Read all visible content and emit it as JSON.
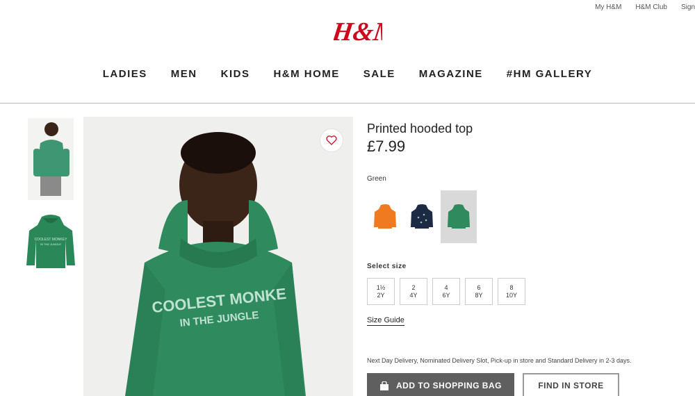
{
  "header": {
    "util_links": [
      "My H&M",
      "H&M Club",
      "Sign"
    ],
    "logo_text": "H&M",
    "nav": [
      "LADIES",
      "MEN",
      "KIDS",
      "H&M HOME",
      "SALE",
      "MAGAZINE",
      "#HM GALLERY"
    ]
  },
  "product": {
    "title": "Printed hooded top",
    "price": "£7.99",
    "color_label": "Green",
    "hoodie_print_line1": "COOLEST MONKE",
    "hoodie_print_line2": "IN THE JUNGLE",
    "swatches": [
      {
        "name": "orange",
        "color": "#ef7a1f"
      },
      {
        "name": "navy",
        "color": "#1c2a44"
      },
      {
        "name": "green",
        "color": "#2f8a5e",
        "selected": true
      }
    ],
    "size_label": "Select size",
    "sizes": [
      {
        "top": "1½",
        "bottom": "2Y"
      },
      {
        "top": "2",
        "bottom": "4Y"
      },
      {
        "top": "4",
        "bottom": "6Y"
      },
      {
        "top": "6",
        "bottom": "8Y"
      },
      {
        "top": "8",
        "bottom": "10Y"
      }
    ],
    "size_guide": "Size Guide",
    "delivery": "Next Day Delivery, Nominated Delivery Slot, Pick-up in store and Standard Delivery in 2-3 days.",
    "add_button": "ADD TO SHOPPING BAG",
    "store_button": "FIND IN STORE"
  },
  "colors": {
    "brand": "#cc071e",
    "hoodie_green": "#2f8a5e"
  }
}
